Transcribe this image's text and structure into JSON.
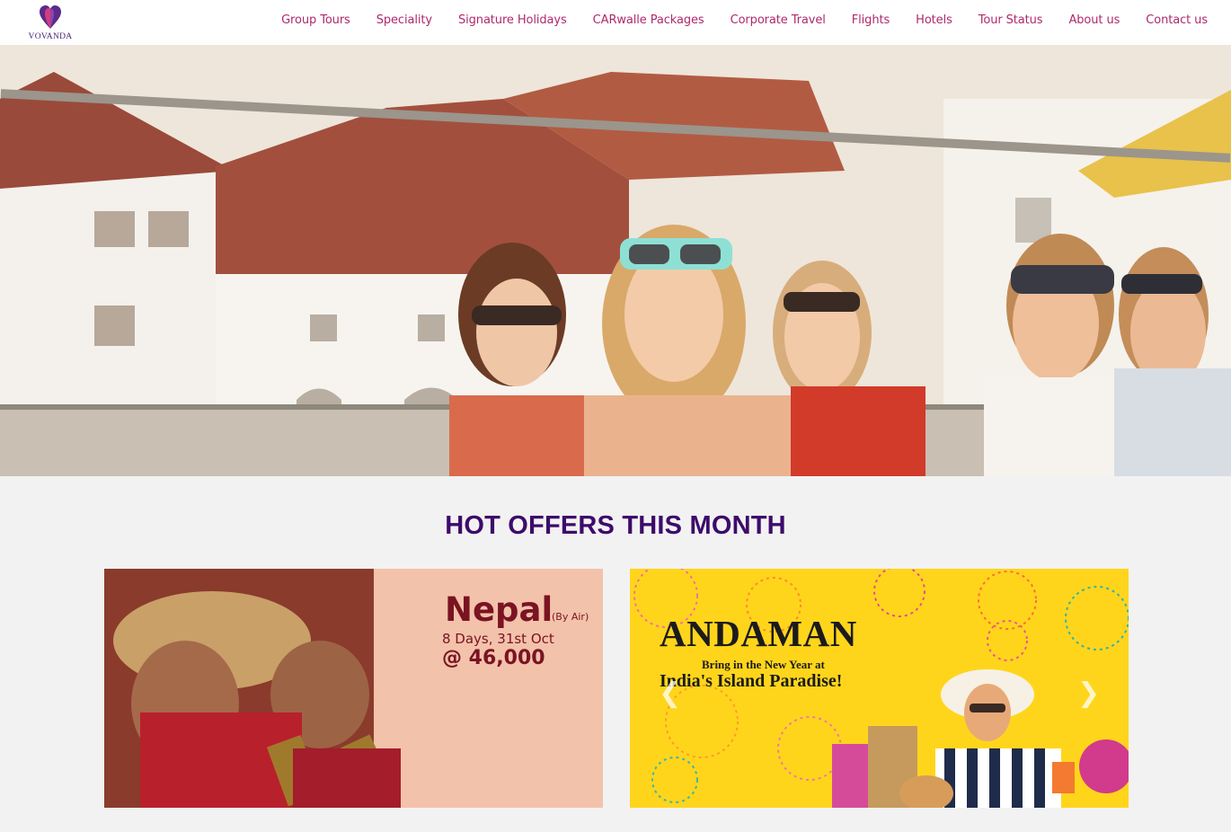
{
  "brand": {
    "name": "VOVANDA",
    "logo_icon": "heart-logo-icon",
    "accent": "#b0286e",
    "logo_color": "#4b2474"
  },
  "nav": {
    "items": [
      {
        "label": "Group Tours"
      },
      {
        "label": "Speciality"
      },
      {
        "label": "Signature Holidays"
      },
      {
        "label": "CARwalle Packages"
      },
      {
        "label": "Corporate Travel"
      },
      {
        "label": "Flights"
      },
      {
        "label": "Hotels"
      },
      {
        "label": "Tour Status"
      },
      {
        "label": "About us"
      },
      {
        "label": "Contact us"
      }
    ]
  },
  "offers": {
    "title": "HOT OFFERS THIS MONTH",
    "title_color": "#3d0b6b",
    "cards": [
      {
        "destination": "Nepal",
        "mode": "(By Air)",
        "duration": "8 Days, 31st Oct",
        "price": "@ 46,000"
      },
      {
        "destination": "ANDAMAN",
        "tagline_1": "Bring in the New Year at",
        "tagline_2": "India's Island Paradise!"
      }
    ],
    "carousel": {
      "prev_icon": "chevron-left-icon",
      "next_icon": "chevron-right-icon"
    }
  }
}
